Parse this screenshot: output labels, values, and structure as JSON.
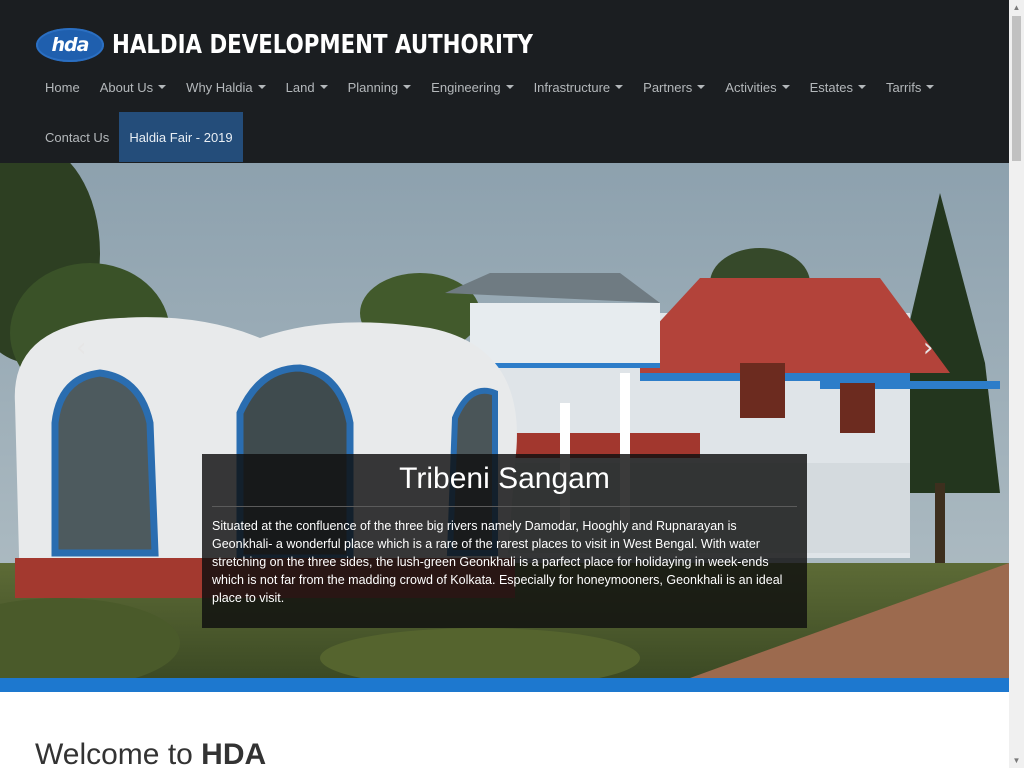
{
  "header": {
    "logo_text": "hda",
    "title": "HALDIA DEVELOPMENT AUTHORITY"
  },
  "nav": {
    "row1": [
      {
        "label": "Home",
        "dropdown": false
      },
      {
        "label": "About Us",
        "dropdown": true
      },
      {
        "label": "Why Haldia",
        "dropdown": true
      },
      {
        "label": "Land",
        "dropdown": true
      },
      {
        "label": "Planning",
        "dropdown": true
      },
      {
        "label": "Engineering",
        "dropdown": true
      },
      {
        "label": "Infrastructure",
        "dropdown": true
      },
      {
        "label": "Partners",
        "dropdown": true
      },
      {
        "label": "Activities",
        "dropdown": true
      },
      {
        "label": "Estates",
        "dropdown": true
      },
      {
        "label": "Tarrifs",
        "dropdown": true
      }
    ],
    "row2": [
      {
        "label": "Contact Us",
        "dropdown": false
      },
      {
        "label": "Haldia Fair - 2019",
        "dropdown": false,
        "active": true
      }
    ]
  },
  "carousel": {
    "prev_icon": "‹",
    "next_icon": "›",
    "caption_title": "Tribeni Sangam",
    "caption_text": "Situated at the confluence of the three big rivers namely Damodar, Hooghly and Rupnarayan is Geonkhali- a wonderful place which is a rare of the rarest places to visit in West Bengal. With water stretching on the three sides, the lush-green Geonkhali is a parfect place for holidaying in week-ends which is not far from the madding crowd of Kolkata. Especially for honeymooners, Geonkhali is an ideal place to visit."
  },
  "welcome": {
    "prefix": "Welcome to ",
    "emphasis": "HDA"
  },
  "colors": {
    "header_bg": "#1b1e21",
    "active_nav": "#244d7a",
    "accent_strip": "#1d78cf"
  }
}
